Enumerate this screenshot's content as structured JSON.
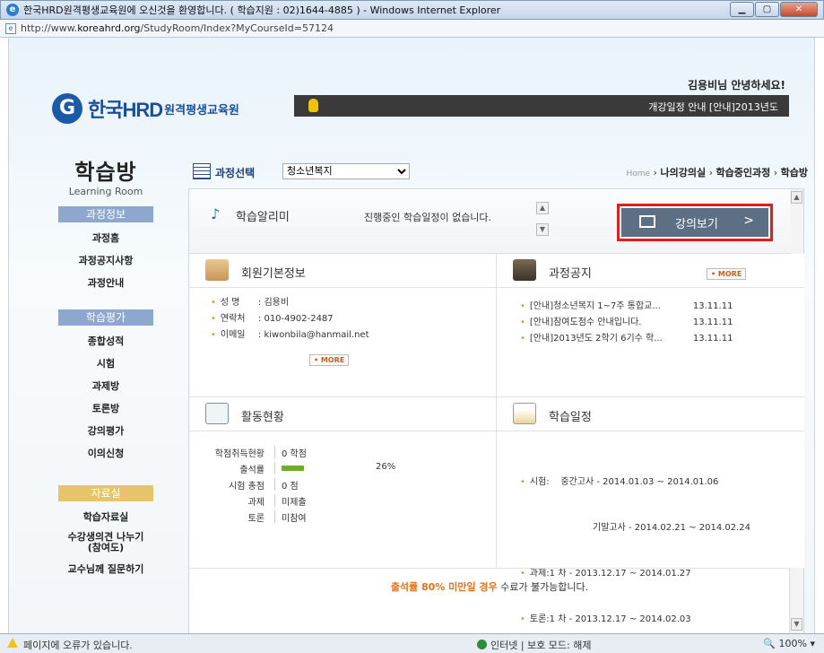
{
  "window": {
    "title": "한국HRD원격평생교육원에 오신것을 환영합니다. ( 학습지원 : 02)1644-4885 ) - Windows Internet Explorer",
    "min": "▁",
    "max": "▢",
    "close": "✕"
  },
  "address": {
    "prefix": "http://www.",
    "host": "koreahrd.org",
    "path": "/StudyRoom/Index?MyCourseId=57124"
  },
  "header": {
    "logo_main": "한국HRD",
    "logo_sub": "원격평생교육원",
    "greeting": "김용비님 안녕하세요!",
    "ticker_text": "개강일정 안내 [안내]2013년도"
  },
  "sidebar": {
    "title": "학습방",
    "subtitle": "Learning Room",
    "sections": [
      {
        "label": "과정정보",
        "items": [
          "과정홈",
          "과정공지사항",
          "과정안내"
        ]
      },
      {
        "label": "학습평가",
        "items": [
          "종합성적",
          "시험",
          "과제방",
          "토론방",
          "강의평가",
          "이의신청"
        ]
      },
      {
        "label": "자료실",
        "items": [
          "학습자료실",
          "수강생의견 나누기\n(참여도)",
          "교수님께 질문하기"
        ]
      }
    ]
  },
  "course_select": {
    "label": "과정선택",
    "value": "청소년복지"
  },
  "breadcrumb": {
    "home": "Home",
    "p1": "나의강의실",
    "p2": "학습중인과정",
    "p3": "학습방"
  },
  "alarm": {
    "title": "학습알리미",
    "message": "진행중인 학습일정이 없습니다."
  },
  "view_button": {
    "label": "강의보기",
    "chevron": ">"
  },
  "member": {
    "title": "회원기본정보",
    "rows": [
      {
        "key": "성 명",
        "value": ": 김용비"
      },
      {
        "key": "연락처",
        "value": ": 010-4902-2487"
      },
      {
        "key": "이메일",
        "value": ": kiwonbila@hanmail.net"
      }
    ],
    "more": "• MORE"
  },
  "notice": {
    "title": "과정공지",
    "more": "• MORE",
    "items": [
      {
        "text": "[안내]청소년복지 1~7주 통합교...",
        "date": "13.11.11"
      },
      {
        "text": "[안내]참여도점수 안내입니다.",
        "date": "13.11.11"
      },
      {
        "text": "[안내]2013년도 2학기 6기수 학...",
        "date": "13.11.11"
      }
    ]
  },
  "activity": {
    "title": "활동현황",
    "rows": [
      {
        "key": "학점취득현황",
        "value": "0 학점"
      },
      {
        "key": "출석률",
        "value": ""
      },
      {
        "key": "시험 총점",
        "value": "0 점"
      },
      {
        "key": "과제",
        "value": "미제출"
      },
      {
        "key": "토론",
        "value": "미참여"
      }
    ],
    "attendance_pct_label": "26%",
    "attendance_fraction": 0.26
  },
  "schedule": {
    "title": "학습일정",
    "lines": [
      "시험:    중간고사 - 2014.01.03 ~ 2014.01.06",
      "기말고사 - 2014.02.21 ~ 2014.02.24",
      "과제:1 차 - 2013.12.17 ~ 2014.01.27",
      "토론:1 차 - 2013.12.17 ~ 2014.02.03"
    ]
  },
  "footnote": {
    "highlight": "출석률 80% 미만일 경우",
    "rest": " 수료가 불가능합니다."
  },
  "statusbar": {
    "text": "페이지에 오류가 있습니다.",
    "zone": "인터넷 | 보호 모드: 해제",
    "zoom": "100%"
  }
}
